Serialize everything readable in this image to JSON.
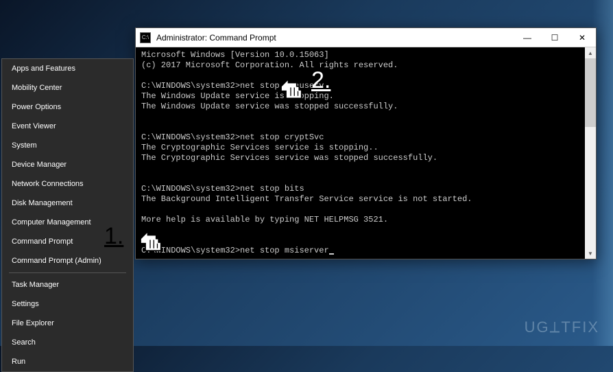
{
  "winx_menu": {
    "items": [
      "Apps and Features",
      "Mobility Center",
      "Power Options",
      "Event Viewer",
      "System",
      "Device Manager",
      "Network Connections",
      "Disk Management",
      "Computer Management",
      "Command Prompt",
      "Command Prompt (Admin)"
    ],
    "items_group2": [
      "Task Manager",
      "Settings",
      "File Explorer",
      "Search",
      "Run"
    ]
  },
  "cmd_window": {
    "icon_text": "C:\\",
    "title": "Administrator: Command Prompt",
    "controls": {
      "minimize": "—",
      "maximize": "☐",
      "close": "✕"
    },
    "output": "Microsoft Windows [Version 10.0.15063]\n(c) 2017 Microsoft Corporation. All rights reserved.\n\nC:\\WINDOWS\\system32>net stop wuauserv\nThe Windows Update service is stopping.\nThe Windows Update service was stopped successfully.\n\n\nC:\\WINDOWS\\system32>net stop cryptSvc\nThe Cryptographic Services service is stopping..\nThe Cryptographic Services service was stopped successfully.\n\n\nC:\\WINDOWS\\system32>net stop bits\nThe Background Intelligent Transfer Service service is not started.\n\nMore help is available by typing NET HELPMSG 3521.\n\n\nC:\\WINDOWS\\system32>net stop msiserver"
  },
  "annotations": {
    "label1": "1.",
    "label2": "2."
  },
  "watermark": "UGETFIX"
}
